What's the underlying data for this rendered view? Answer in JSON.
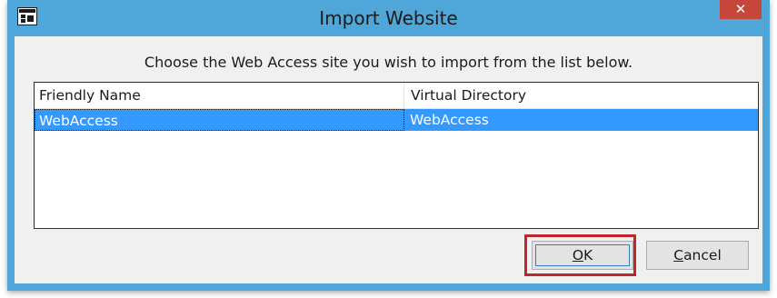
{
  "window": {
    "title": "Import Website",
    "close_icon": "close-icon"
  },
  "dialog": {
    "instruction": "Choose the Web Access site you wish to import from the list below."
  },
  "list": {
    "columns": [
      "Friendly Name",
      "Virtual Directory"
    ],
    "rows": [
      {
        "friendly_name": "WebAccess",
        "virtual_directory": "WebAccess",
        "selected": true
      }
    ]
  },
  "buttons": {
    "ok_mnemonic": "O",
    "ok_rest": "K",
    "cancel_mnemonic": "C",
    "cancel_rest": "ancel"
  },
  "colors": {
    "titlebar": "#4fa6d8",
    "close_button": "#c7463b",
    "selection": "#3399ff",
    "highlight_box": "#c0262b"
  }
}
